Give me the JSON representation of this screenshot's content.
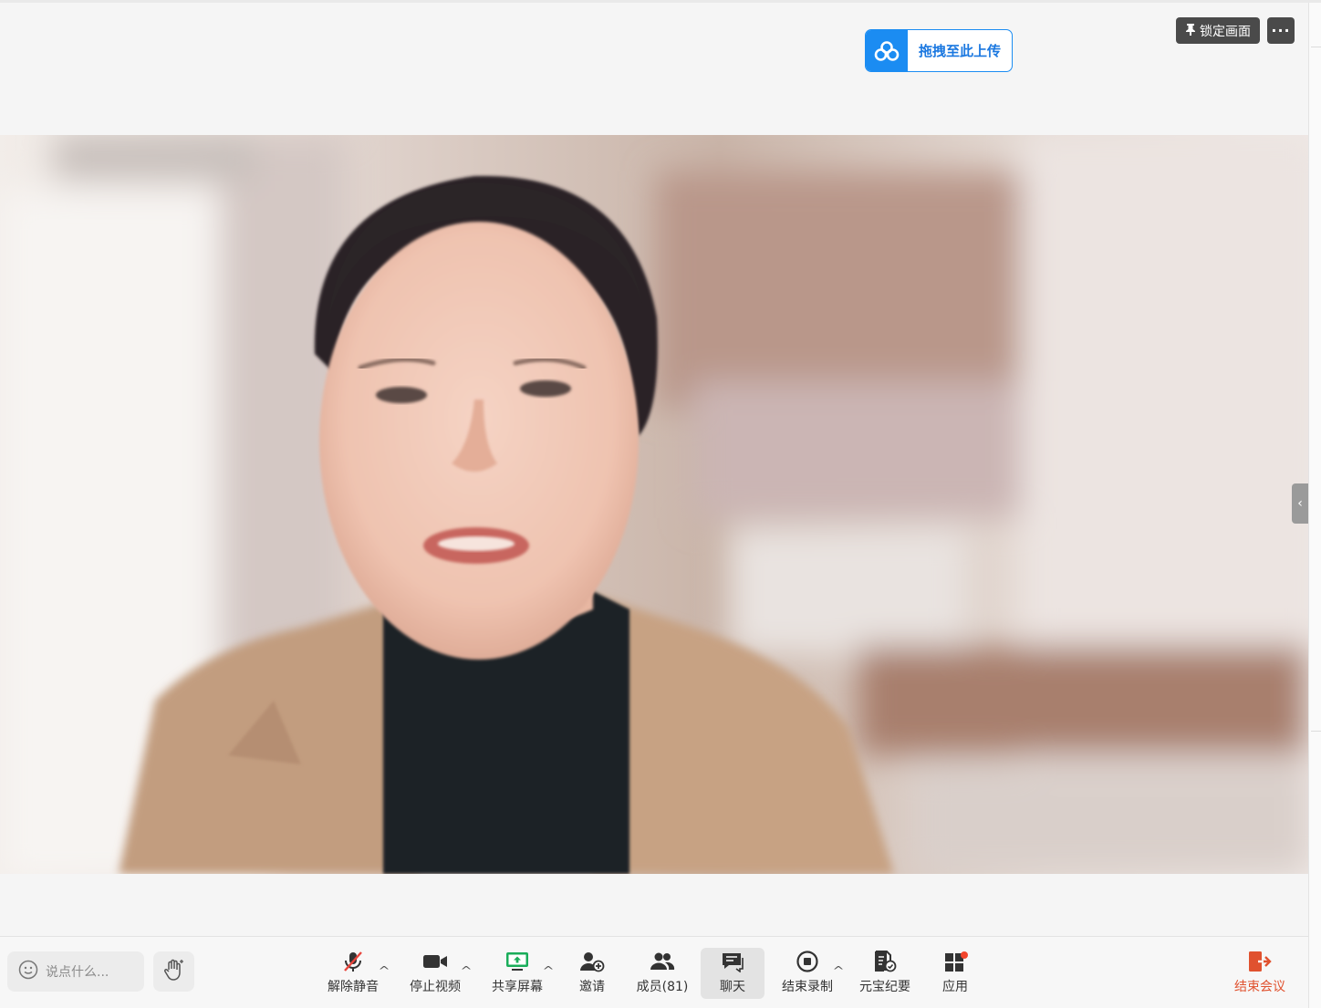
{
  "header": {
    "upload_label": "拖拽至此上传",
    "lock_label": "锁定画面",
    "more_label": "···"
  },
  "video": {
    "participant_description": "speaker video feed"
  },
  "toolbar": {
    "chat_placeholder": "说点什么...",
    "tools": {
      "unmute": "解除静音",
      "stop_video": "停止视频",
      "share_screen": "共享屏幕",
      "invite": "邀请",
      "members": "成员(81)",
      "chat": "聊天",
      "stop_record": "结束录制",
      "yuanbao_minutes": "元宝纪要",
      "apps": "应用"
    },
    "end_meeting": "结束会议"
  },
  "colors": {
    "accent": "#1b8cf2",
    "end_meeting": "#e0522f",
    "share_green": "#1aad5a",
    "muted_red": "#e8453c"
  }
}
